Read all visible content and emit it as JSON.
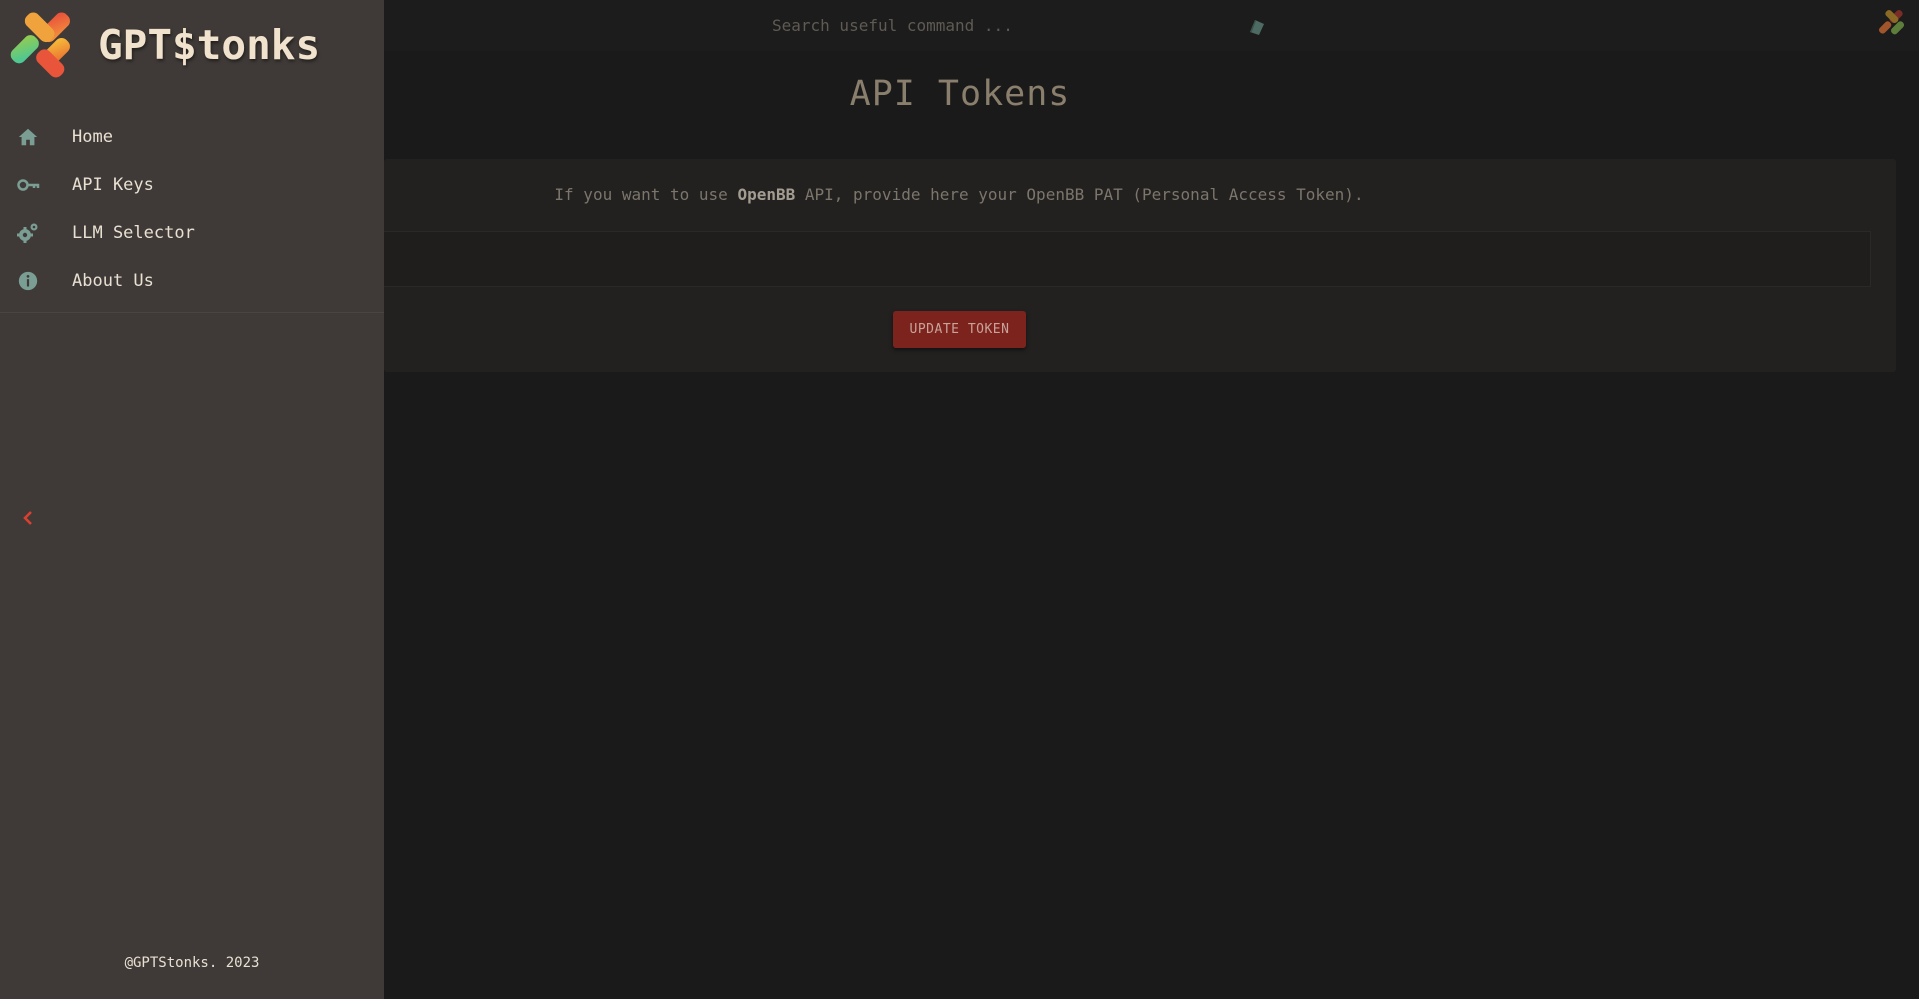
{
  "app": {
    "brand_name": "GPT$tonks",
    "footer": "@GPTStonks. 2023"
  },
  "search": {
    "placeholder": "Search useful command ..."
  },
  "sidebar": {
    "items": [
      {
        "label": "Home",
        "icon": "home-icon"
      },
      {
        "label": "API Keys",
        "icon": "key-icon"
      },
      {
        "label": "LLM Selector",
        "icon": "gears-icon"
      },
      {
        "label": "About Us",
        "icon": "info-icon"
      }
    ],
    "collapse_icon": "chevron-left-icon"
  },
  "main": {
    "title": "API Tokens",
    "description_prefix": "If you want to use ",
    "description_bold": "OpenBB",
    "description_suffix": " API, provide here your OpenBB PAT (Personal Access Token).",
    "token_value": "",
    "update_button": "UPDATE TOKEN"
  },
  "colors": {
    "sidebar_bg": "#3f3a37",
    "accent_red": "#7d231e",
    "icon_teal": "#7a9e94",
    "background": "#1a1a1a"
  }
}
